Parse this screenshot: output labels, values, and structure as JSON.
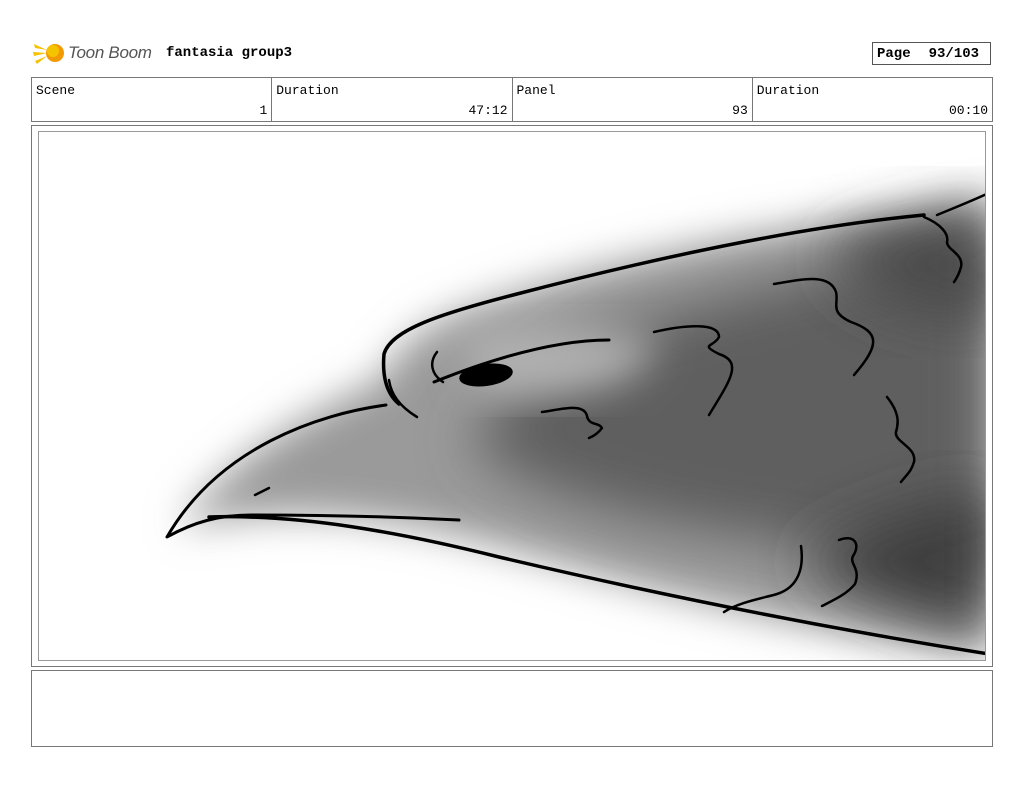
{
  "header": {
    "brand": "Toon Boom",
    "project_title": "fantasia group3",
    "page_label": "Page",
    "page_value": "93/103"
  },
  "info": {
    "scene_label": "Scene",
    "scene_value": "1",
    "duration_label": "Duration",
    "duration_value": "47:12",
    "panel_label": "Panel",
    "panel_value": "93",
    "panel_duration_label": "Duration",
    "panel_duration_value": "00:10"
  },
  "icons": {
    "logo": "toon-boom-logo-icon"
  },
  "colors": {
    "logo_yellow": "#f5c400",
    "logo_orange": "#f29a00"
  }
}
